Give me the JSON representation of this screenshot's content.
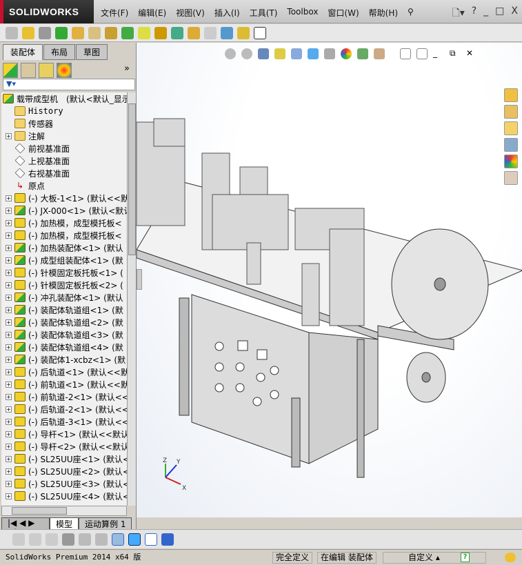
{
  "app": {
    "logo": "SOLIDWORKS"
  },
  "menu": [
    "文件(F)",
    "编辑(E)",
    "视图(V)",
    "插入(I)",
    "工具(T)",
    "Toolbox",
    "窗口(W)",
    "帮助(H)"
  ],
  "window_controls": {
    "help": "?",
    "minimize": "_",
    "restore": "□",
    "close": "X"
  },
  "left_panel": {
    "tabs": [
      "装配体",
      "布局",
      "草图"
    ],
    "more": "»",
    "filter_icon": "filter-icon",
    "tree": [
      {
        "label": "载带成型机　(默认<默认_显示",
        "icon": "assembly",
        "expander": false
      },
      {
        "label": "History",
        "icon": "history-folder",
        "expander": false
      },
      {
        "label": "传感器",
        "icon": "sensor-folder",
        "expander": false
      },
      {
        "label": "注解",
        "icon": "annotation-folder",
        "expander": true
      },
      {
        "label": "前视基准面",
        "icon": "plane",
        "expander": false
      },
      {
        "label": "上视基准面",
        "icon": "plane",
        "expander": false
      },
      {
        "label": "右视基准面",
        "icon": "plane",
        "expander": false
      },
      {
        "label": "原点",
        "icon": "origin",
        "expander": false
      },
      {
        "label": "(-) 大板-1<1> (默认<<默",
        "icon": "part",
        "expander": true
      },
      {
        "label": "(-) JX-000<1> (默认<默认",
        "icon": "assembly",
        "expander": true
      },
      {
        "label": "(-) 加热模，成型模托板<",
        "icon": "part",
        "expander": true
      },
      {
        "label": "(-) 加热模，成型模托板<",
        "icon": "part",
        "expander": true
      },
      {
        "label": "(-) 加热装配体<1> (默认",
        "icon": "assembly",
        "expander": true
      },
      {
        "label": "(-) 成型组装配体<1> (默",
        "icon": "assembly",
        "expander": true
      },
      {
        "label": "(-) 针模固定板托板<1> (",
        "icon": "part",
        "expander": true
      },
      {
        "label": "(-) 针模固定板托板<2> (",
        "icon": "part",
        "expander": true
      },
      {
        "label": "(-) 冲孔装配体<1> (默认",
        "icon": "assembly",
        "expander": true
      },
      {
        "label": "(-) 装配体轨道组<1> (默",
        "icon": "assembly",
        "expander": true
      },
      {
        "label": "(-) 装配体轨道组<2> (默",
        "icon": "assembly",
        "expander": true
      },
      {
        "label": "(-) 装配体轨道组<3> (默",
        "icon": "assembly",
        "expander": true
      },
      {
        "label": "(-) 装配体轨道组<4> (默",
        "icon": "assembly",
        "expander": true
      },
      {
        "label": "(-) 装配体1-xcbz<1> (默",
        "icon": "assembly",
        "expander": true
      },
      {
        "label": "(-) 后轨道<1> (默认<<默",
        "icon": "part",
        "expander": true
      },
      {
        "label": "(-) 前轨道<1> (默认<<默",
        "icon": "part",
        "expander": true
      },
      {
        "label": "(-) 前轨道-2<1> (默认<<",
        "icon": "part",
        "expander": true
      },
      {
        "label": "(-) 后轨道-2<1> (默认<<",
        "icon": "part",
        "expander": true
      },
      {
        "label": "(-) 后轨道-3<1> (默认<<",
        "icon": "part",
        "expander": true
      },
      {
        "label": "(-) 导杆<1> (默认<<默认",
        "icon": "part",
        "expander": true
      },
      {
        "label": "(-) 导杆<2> (默认<<默认",
        "icon": "part",
        "expander": true
      },
      {
        "label": "(-) SL25UU座<1> (默认<<",
        "icon": "part",
        "expander": true
      },
      {
        "label": "(-) SL25UU座<2> (默认<<",
        "icon": "part",
        "expander": true
      },
      {
        "label": "(-) SL25UU座<3> (默认<<",
        "icon": "part",
        "expander": true
      },
      {
        "label": "(-) SL25UU座<4> (默认<<",
        "icon": "part",
        "expander": true
      }
    ],
    "bottom_tabs": [
      "模型",
      "运动算例 1"
    ]
  },
  "triad": {
    "x": "X",
    "y": "Y",
    "z": "Z"
  },
  "status": {
    "app": "SolidWorks Premium 2014 x64 版",
    "defined": "完全定义",
    "editing": "在编辑 装配体",
    "units": "自定义",
    "help": "?"
  },
  "colors": {
    "title_bg": "#2a2a2a",
    "logo_accent": "#c8102e",
    "model_orange": "#e07a10",
    "viewport_bg": "#ffffff"
  }
}
